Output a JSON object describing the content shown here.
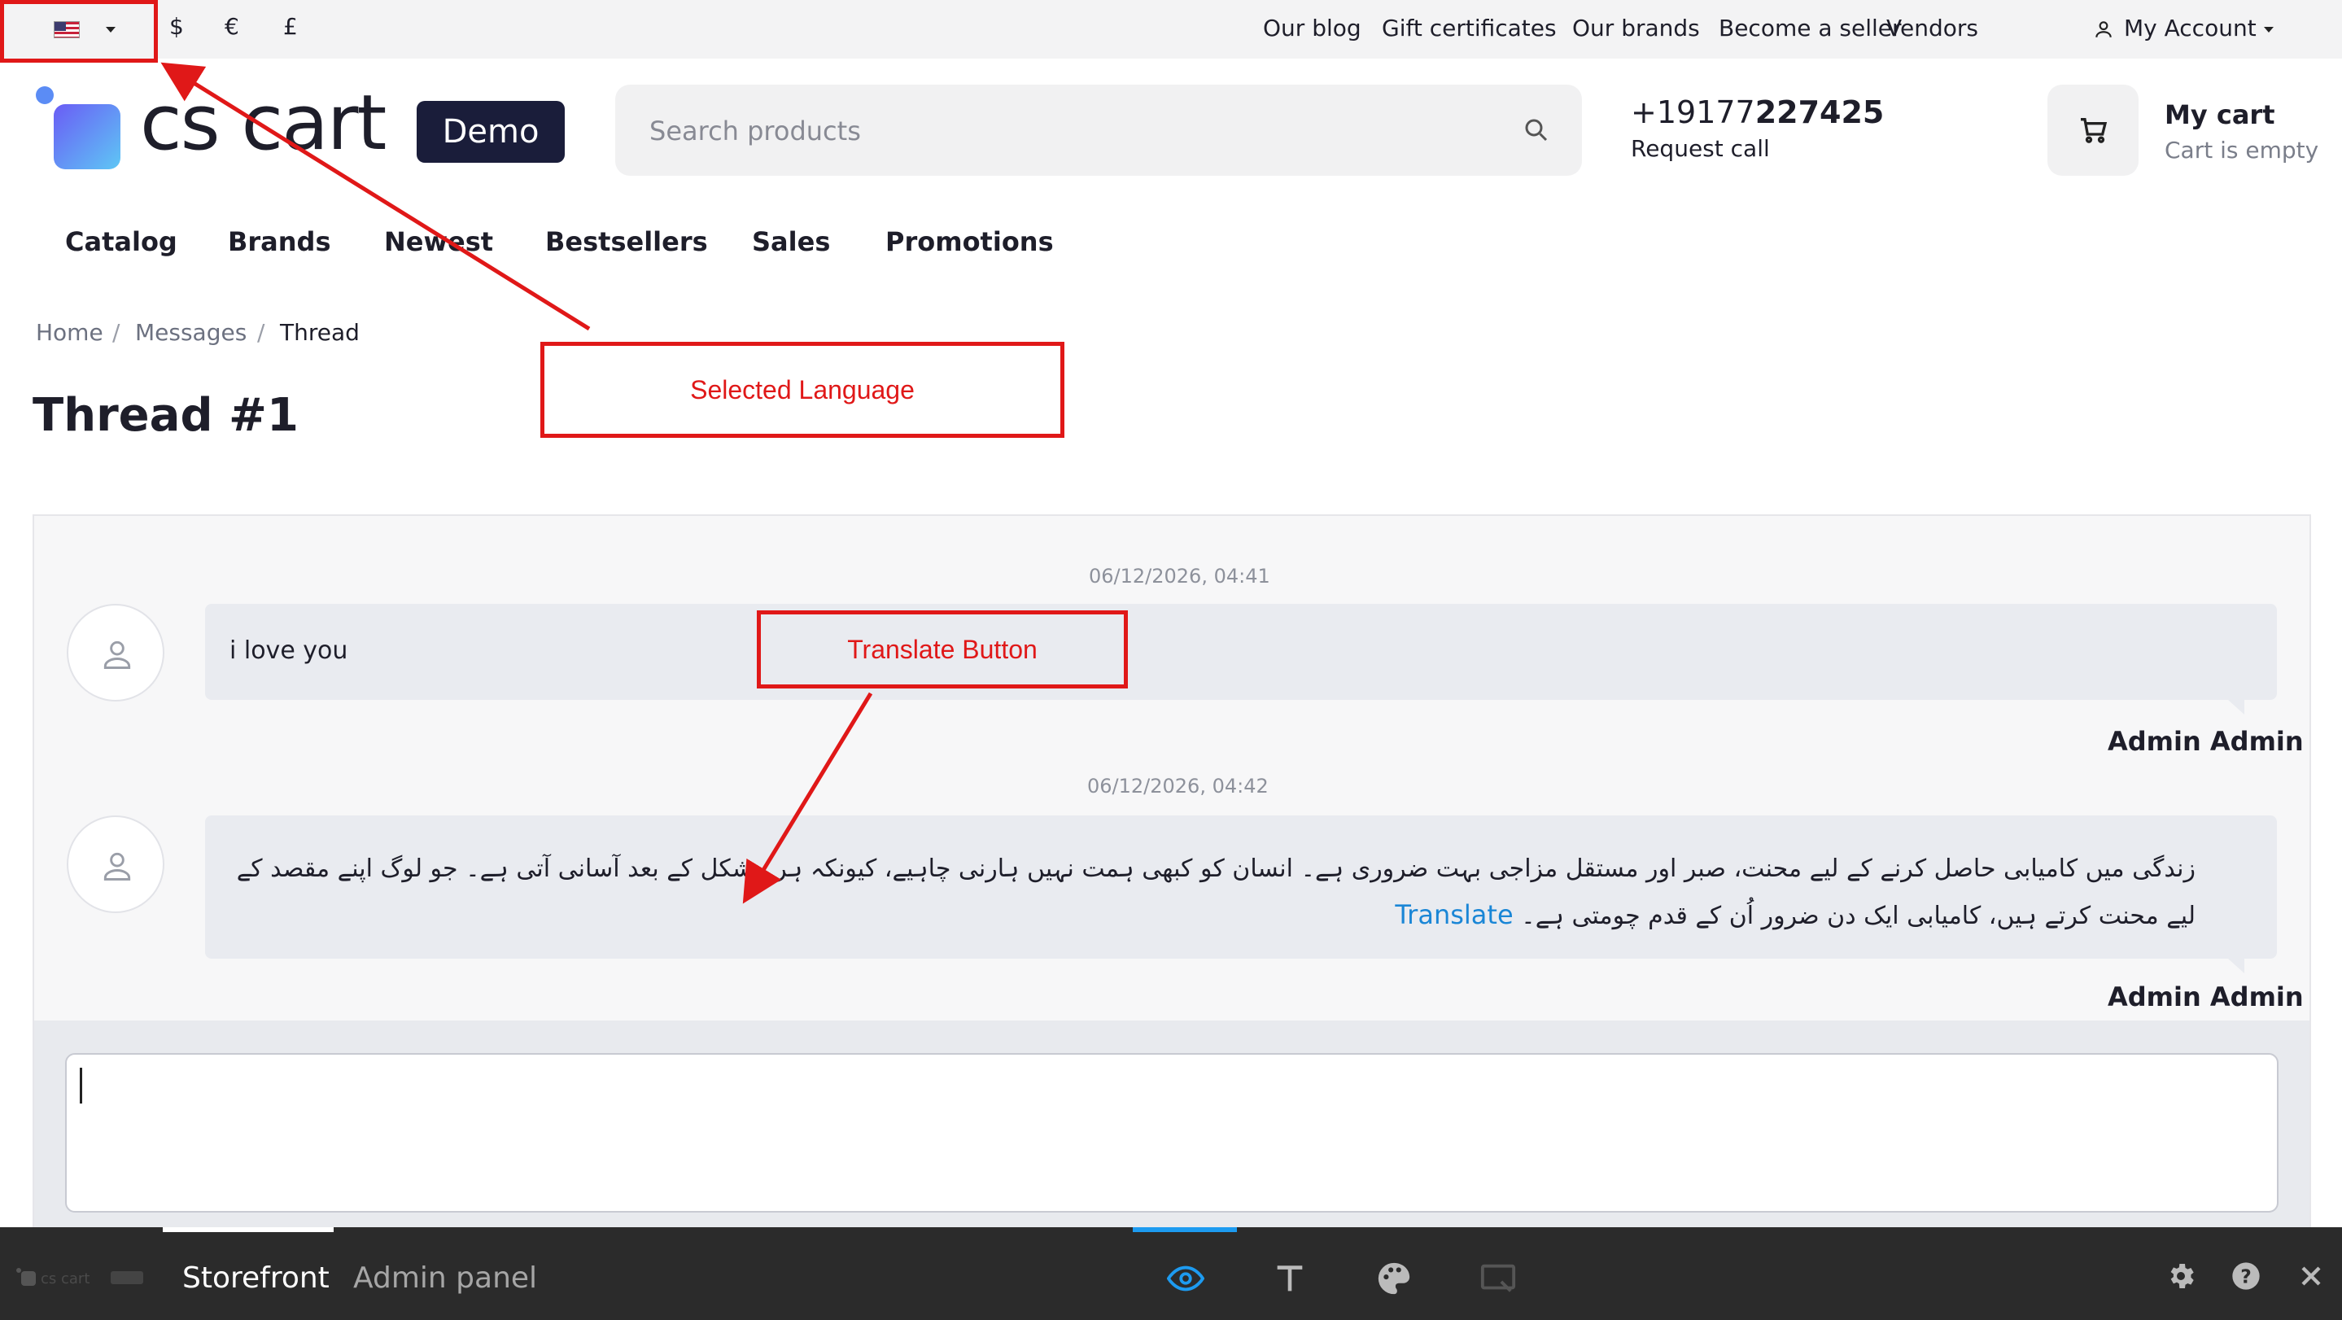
{
  "topbar": {
    "currencies": [
      "$",
      "€",
      "£"
    ],
    "links": [
      "Our blog",
      "Gift certificates",
      "Our brands",
      "Become a seller",
      "Vendors"
    ],
    "account_label": "My Account"
  },
  "header": {
    "logo_text": "cs cart",
    "demo_label": "Demo",
    "search_placeholder": "Search products",
    "phone_prefix": "+19177",
    "phone_bold": "227425",
    "request_call": "Request call",
    "cart_title": "My cart",
    "cart_status": "Cart is empty"
  },
  "nav": [
    "Catalog",
    "Brands",
    "Newest",
    "Bestsellers",
    "Sales",
    "Promotions"
  ],
  "breadcrumb": [
    "Home",
    "/",
    "Messages",
    "/",
    "Thread"
  ],
  "page_title": "Thread #1",
  "thread": {
    "messages": [
      {
        "timestamp": "06/12/2026, 04:41",
        "text": "i love you",
        "author": "Admin Admin"
      },
      {
        "timestamp": "06/12/2026, 04:42",
        "text": "زندگی میں کامیابی حاصل کرنے کے لیے محنت، صبر اور مستقل مزاجی بہت ضروری ہے۔ انسان کو کبھی ہمت نہیں ہارنی چاہیے، کیونکہ ہر مشکل کے بعد آسانی آتی ہے۔ جو لوگ اپنے مقصد کے لیے محنت کرتے ہیں، کامیابی ایک دن ضرور اُن کے قدم چومتی ہے۔",
        "translate_label": "Translate",
        "author": "Admin Admin"
      }
    ]
  },
  "annotations": {
    "selected_language": "Selected Language",
    "translate_button": "Translate Button",
    "color": "#e01818"
  },
  "bottom_bar": {
    "tabs": [
      "Storefront",
      "Admin panel"
    ],
    "tools": [
      "eye-icon",
      "text-icon",
      "palette-icon",
      "screen-select-icon"
    ],
    "right_icons": [
      "gear-icon",
      "help-icon",
      "close-icon"
    ],
    "accent_color": "#1d9bf0"
  }
}
